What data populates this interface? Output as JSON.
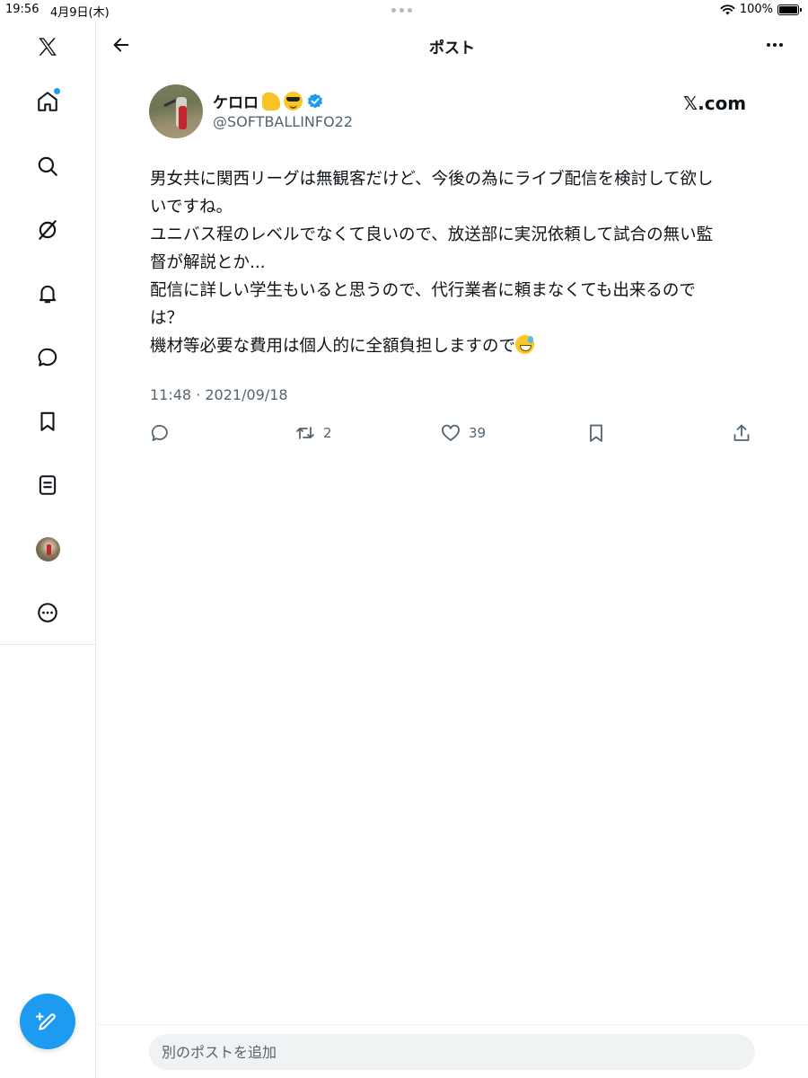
{
  "status_bar": {
    "time": "19:56",
    "date": "4月9日(木)",
    "battery": "100%",
    "battery_level": 1.0
  },
  "sidebar": {
    "items": [
      {
        "name": "x-logo-icon"
      },
      {
        "name": "home-icon",
        "notification": true
      },
      {
        "name": "search-icon"
      },
      {
        "name": "grok-icon"
      },
      {
        "name": "bell-icon"
      },
      {
        "name": "message-icon"
      },
      {
        "name": "bookmark-icon"
      },
      {
        "name": "list-icon"
      },
      {
        "name": "profile-avatar"
      },
      {
        "name": "more-circle-icon"
      }
    ],
    "compose_icon": "compose-icon"
  },
  "header": {
    "title": "ポスト"
  },
  "tweet": {
    "display_name": "ケロロ",
    "emojis": [
      "flexed-biceps",
      "smiling-face-with-sunglasses"
    ],
    "verified": true,
    "handle": "@SOFTBALLINFO22",
    "source_label": "𝕏.com",
    "lines": [
      "男女共に関西リーグは無観客だけど、今後の為にライブ配信を検討して欲し",
      "いですね。",
      "ユニバス程のレベルでなくて良いので、放送部に実況依頼して試合の無い監",
      "督が解説とか...",
      "配信に詳しい学生もいると思うので、代行業者に頼まなくても出来るので",
      "は？",
      "機材等必要な費用は個人的に全額負担しますので"
    ],
    "trailing_emoji": "grinning-face-with-sweat",
    "timestamp": "11:48 · 2021/09/18",
    "actions": {
      "reply_count": "",
      "repost_count": "2",
      "like_count": "39"
    }
  },
  "reply": {
    "placeholder": "別のポストを追加"
  },
  "colors": {
    "accent": "#1d9bf0",
    "text": "#0f1419",
    "muted": "#536471",
    "divider": "#e6e6e6"
  }
}
